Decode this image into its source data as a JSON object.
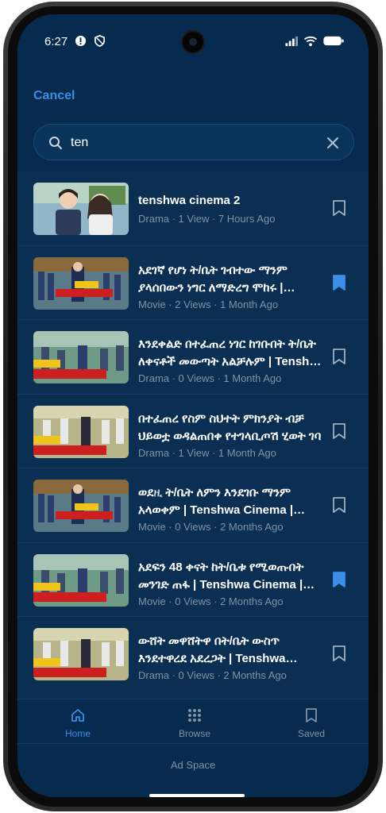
{
  "status_bar": {
    "time": "6:27"
  },
  "header": {
    "cancel_label": "Cancel"
  },
  "search": {
    "value": "ten"
  },
  "results": [
    {
      "title": "tenshwa cinema 2",
      "meta": "Drama · 1 View · 7 Hours Ago",
      "saved": false
    },
    {
      "title": "አደገኛ የሆነ ት/ቤት ገብተው ማንም ያላሰበውን ነግር ለማድረግ ሞከሩ | Tenshwa Cinema",
      "meta": "Movie · 2 Views · 1 Month Ago",
      "saved": true
    },
    {
      "title": "እንደቀልድ በተፈጠረ ነገር ከገቡበት ት/ቤት ለቀናቶች መውጣት አልቻሉም | Tenshwa Cinema",
      "meta": "Drama · 0 Views · 1 Month Ago",
      "saved": false
    },
    {
      "title": "በተፈጠረ የስም ስህተት ምክንያት ብቻ ህይወቷ ወዳልጠበቀ የተገላቢጦሽ ሂወት ገባ",
      "meta": "Drama · 1 View · 1 Month Ago",
      "saved": false
    },
    {
      "title": "ወደዚ ት/ቤት ለምን እንደገቡ ማንም አላወቀም | Tenshwa Cinema | Kdrama",
      "meta": "Movie · 0 Views · 2 Months Ago",
      "saved": false
    },
    {
      "title": "አደፍን 48 ቀናት ከት/ቤቱ የሚወጡበት መንገድ ጠፋ | Tenshwa Cinema | Kdrama",
      "meta": "Movie · 0 Views · 2 Months Ago",
      "saved": true
    },
    {
      "title": "ውሸት መዋሸትዋ በት/ቤት ውስጥ እንደተዋረደ አደረጋት | Tenshwa Cinema",
      "meta": "Drama · 0 Views · 2 Months Ago",
      "saved": false
    }
  ],
  "nav": {
    "home_label": "Home",
    "browse_label": "Browse",
    "saved_label": "Saved"
  },
  "ad_label": "Ad Space",
  "colors": {
    "accent": "#3b8ee8",
    "background": "#062b4f",
    "list_bg": "#0a2f53",
    "muted": "#7e93a9"
  }
}
